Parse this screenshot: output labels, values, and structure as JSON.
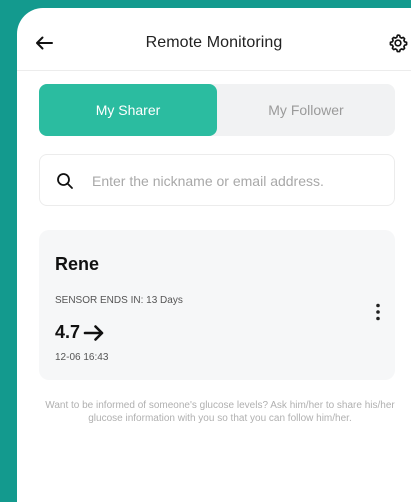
{
  "header": {
    "title": "Remote Monitoring",
    "back_icon": "arrow-left-icon",
    "settings_icon": "gear-icon"
  },
  "tabs": [
    {
      "label": "My Sharer",
      "active": true
    },
    {
      "label": "My Follower",
      "active": false
    }
  ],
  "search": {
    "placeholder": "Enter the nickname or email address.",
    "value": ""
  },
  "sharer_card": {
    "name": "Rene",
    "sensor_label": "SENSOR ENDS IN: 13 Days",
    "glucose_value": "4.7",
    "trend_icon": "arrow-right-icon",
    "timestamp": "12-06 16:43"
  },
  "info_text": "Want to be informed of someone's glucose levels? Ask him/her to share his/her glucose information with you so that you can follow him/her.",
  "colors": {
    "background": "#139a8e",
    "accent": "#2bbca0",
    "card": "#f6f7f8"
  }
}
